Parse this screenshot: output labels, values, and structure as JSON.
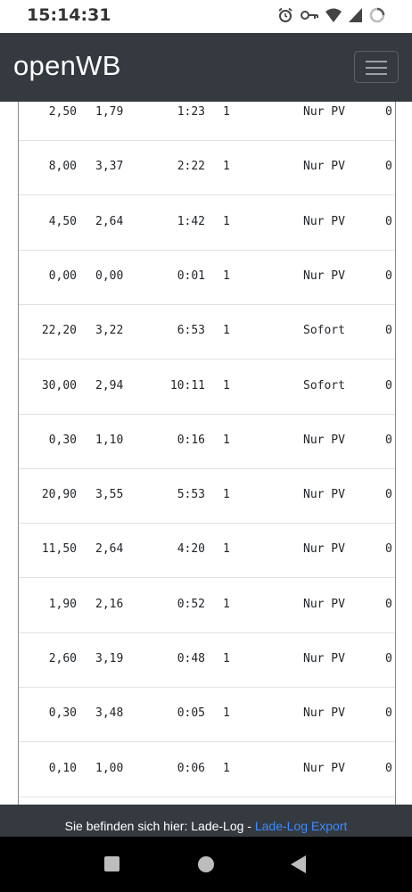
{
  "status_bar": {
    "time": "15:14:31",
    "icons": [
      "alarm-icon",
      "key-icon",
      "wifi-icon",
      "signal-icon",
      "loading-icon"
    ]
  },
  "navbar": {
    "brand": "openWB",
    "toggler_icon": "hamburger-icon"
  },
  "table": {
    "rows": [
      {
        "kwh": "2,50",
        "kw": "1,79",
        "duration": "1:23",
        "count": "1",
        "mode": "Nur PV",
        "last": "0"
      },
      {
        "kwh": "8,00",
        "kw": "3,37",
        "duration": "2:22",
        "count": "1",
        "mode": "Nur PV",
        "last": "0"
      },
      {
        "kwh": "4,50",
        "kw": "2,64",
        "duration": "1:42",
        "count": "1",
        "mode": "Nur PV",
        "last": "0"
      },
      {
        "kwh": "0,00",
        "kw": "0,00",
        "duration": "0:01",
        "count": "1",
        "mode": "Nur PV",
        "last": "0"
      },
      {
        "kwh": "22,20",
        "kw": "3,22",
        "duration": "6:53",
        "count": "1",
        "mode": "Sofort",
        "last": "0"
      },
      {
        "kwh": "30,00",
        "kw": "2,94",
        "duration": "10:11",
        "count": "1",
        "mode": "Sofort",
        "last": "0"
      },
      {
        "kwh": "0,30",
        "kw": "1,10",
        "duration": "0:16",
        "count": "1",
        "mode": "Nur PV",
        "last": "0"
      },
      {
        "kwh": "20,90",
        "kw": "3,55",
        "duration": "5:53",
        "count": "1",
        "mode": "Nur PV",
        "last": "0"
      },
      {
        "kwh": "11,50",
        "kw": "2,64",
        "duration": "4:20",
        "count": "1",
        "mode": "Nur PV",
        "last": "0"
      },
      {
        "kwh": "1,90",
        "kw": "2,16",
        "duration": "0:52",
        "count": "1",
        "mode": "Nur PV",
        "last": "0"
      },
      {
        "kwh": "2,60",
        "kw": "3,19",
        "duration": "0:48",
        "count": "1",
        "mode": "Nur PV",
        "last": "0"
      },
      {
        "kwh": "0,30",
        "kw": "3,48",
        "duration": "0:05",
        "count": "1",
        "mode": "Nur PV",
        "last": "0"
      },
      {
        "kwh": "0,10",
        "kw": "1,00",
        "duration": "0:06",
        "count": "1",
        "mode": "Nur PV",
        "last": "0"
      }
    ]
  },
  "footer": {
    "prefix": "Sie befinden sich hier: Lade-Log - ",
    "link": "Lade-Log Export"
  },
  "system_nav": {
    "icons": [
      "overview-icon",
      "home-icon",
      "back-icon"
    ]
  }
}
